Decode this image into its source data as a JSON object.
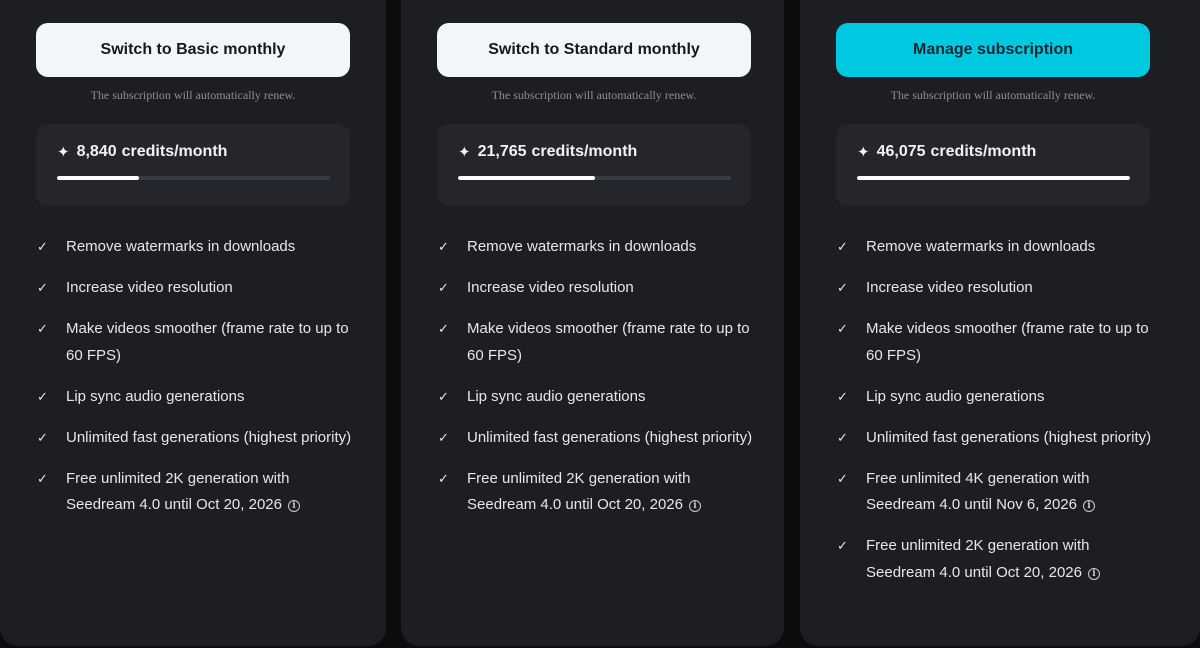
{
  "plans": [
    {
      "button_label": "Switch to Basic monthly",
      "renew_note": "The subscription will automatically renew.",
      "credits_amount": "8,840",
      "credits_unit": "credits/month",
      "credits_progress": 0.3,
      "features": [
        "Remove watermarks in downloads",
        "Increase video resolution",
        "Make videos smoother (frame rate to up to 60 FPS)",
        "Lip sync audio generations",
        "Unlimited fast generations (highest priority)",
        "Free unlimited 2K generation with Seedream 4.0 until Oct 20, 2026"
      ]
    },
    {
      "button_label": "Switch to Standard monthly",
      "renew_note": "The subscription will automatically renew.",
      "credits_amount": "21,765",
      "credits_unit": "credits/month",
      "credits_progress": 0.5,
      "features": [
        "Remove watermarks in downloads",
        "Increase video resolution",
        "Make videos smoother (frame rate to up to 60 FPS)",
        "Lip sync audio generations",
        "Unlimited fast generations (highest priority)",
        "Free unlimited 2K generation with Seedream 4.0 until Oct 20, 2026"
      ]
    },
    {
      "button_label": "Manage subscription",
      "renew_note": "The subscription will automatically renew.",
      "credits_amount": "46,075",
      "credits_unit": "credits/month",
      "credits_progress": 1.0,
      "features": [
        "Remove watermarks in downloads",
        "Increase video resolution",
        "Make videos smoother (frame rate to up to 60 FPS)",
        "Lip sync audio generations",
        "Unlimited fast generations (highest priority)",
        "Free unlimited 4K generation with Seedream 4.0 until Nov 6, 2026",
        "Free unlimited 2K generation with Seedream 4.0 until Oct 20, 2026"
      ]
    }
  ],
  "icons": {
    "sparkle": "sparkle-icon",
    "check": "check-icon",
    "info": "info-icon"
  },
  "colors": {
    "accent": "#00c8e0",
    "card_bg": "#1d1e22",
    "page_bg": "#0b0c0e"
  }
}
